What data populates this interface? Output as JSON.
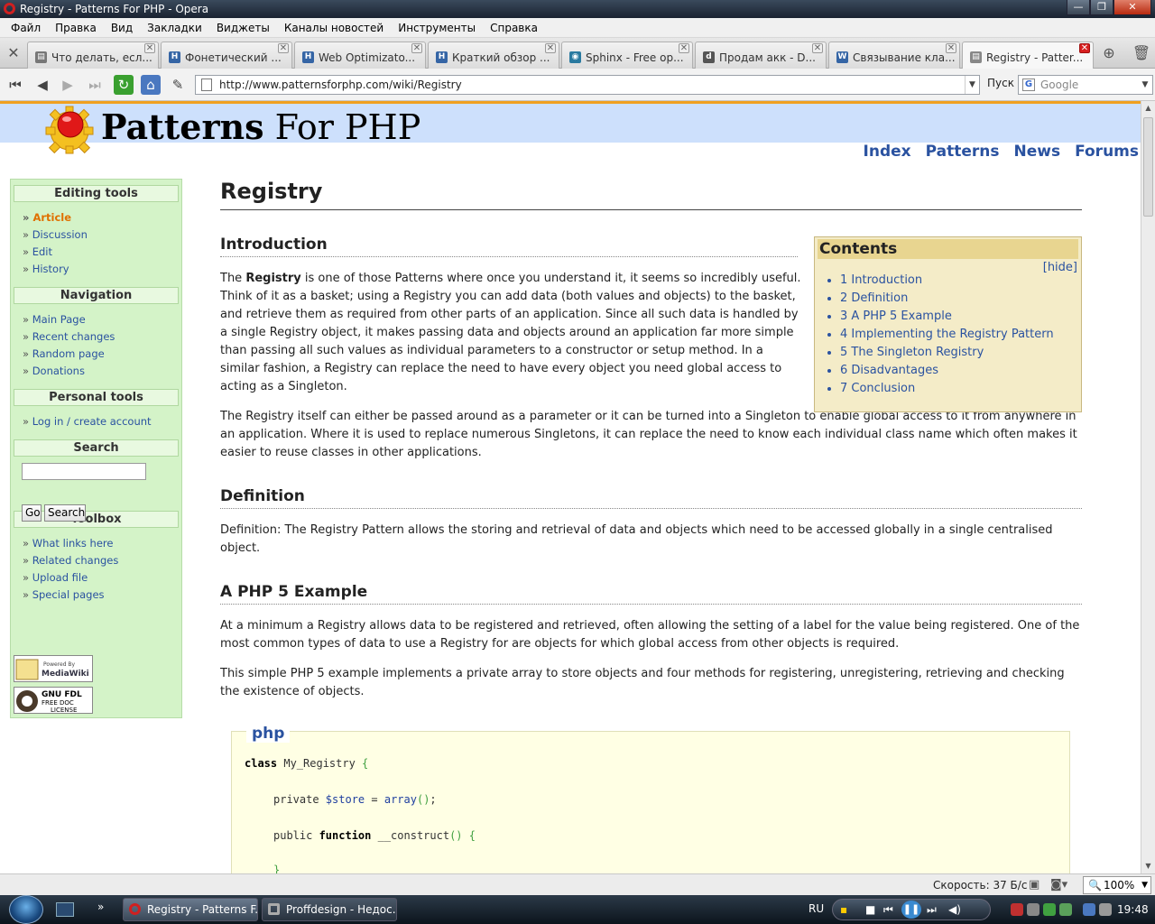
{
  "window": {
    "title": "Registry - Patterns For PHP - Opera"
  },
  "menu": [
    "Файл",
    "Правка",
    "Вид",
    "Закладки",
    "Виджеты",
    "Каналы новостей",
    "Инструменты",
    "Справка"
  ],
  "tabs": [
    {
      "label": "Что делать, есл...",
      "icon": "page-icon"
    },
    {
      "label": "Фонетический ...",
      "icon": "H"
    },
    {
      "label": "Web Optimizato...",
      "icon": "H"
    },
    {
      "label": "Краткий обзор ...",
      "icon": "H"
    },
    {
      "label": "Sphinx - Free op...",
      "icon": "eye-icon"
    },
    {
      "label": "Продам акк - D...",
      "icon": "dp"
    },
    {
      "label": "Связывание кла...",
      "icon": "W"
    },
    {
      "label": "Registry - Patter...",
      "icon": "page-icon",
      "active": true
    }
  ],
  "address": {
    "url": "http://www.patternsforphp.com/wiki/Registry",
    "go_label": "Пуск"
  },
  "search": {
    "placeholder": "Google"
  },
  "site": {
    "title_bold": "Patterns",
    "title_rest": " For PHP",
    "nav": [
      "Index",
      "Patterns",
      "News",
      "Forums"
    ]
  },
  "sidebar": {
    "editing": {
      "title": "Editing tools",
      "items": [
        "Article",
        "Discussion",
        "Edit",
        "History"
      ]
    },
    "navigation": {
      "title": "Navigation",
      "items": [
        "Main Page",
        "Recent changes",
        "Random page",
        "Donations"
      ]
    },
    "personal": {
      "title": "Personal tools",
      "items": [
        "Log in / create account"
      ]
    },
    "search": {
      "title": "Search",
      "go": "Go",
      "search": "Search"
    },
    "toolbox": {
      "title": "Toolbox",
      "items": [
        "What links here",
        "Related changes",
        "Upload file",
        "Special pages"
      ]
    },
    "badges": {
      "mediawiki": "Powered By MediaWiki",
      "gnu": "GNU FDL FREE DOC LICENSE"
    }
  },
  "article": {
    "title": "Registry",
    "intro_heading": "Introduction",
    "intro_p1_pre": "The ",
    "intro_p1_bold": "Registry",
    "intro_p1_post": " is one of those Patterns where once you understand it, it seems so incredibly useful. Think of it as a basket; using a Registry you can add data (both values and objects) to the basket, and retrieve them as required from other parts of an application. Since all such data is handled by a single Registry object, it makes passing data and objects around an application far more simple than passing all such values as individual parameters to a constructor or setup method. In a similar fashion, a Registry can replace the need to have every object you need global access to acting as a Singleton.",
    "intro_p2": "The Registry itself can either be passed around as a parameter or it can be turned into a Singleton to enable global access to it from anywhere in an application. Where it is used to replace numerous Singletons, it can replace the need to know each individual class name which often makes it easier to reuse classes in other applications.",
    "def_heading": "Definition",
    "def_p": "Definition: The Registry Pattern allows the storing and retrieval of data and objects which need to be accessed globally in a single centralised object.",
    "example_heading": "A PHP 5 Example",
    "example_p1": "At a minimum a Registry allows data to be registered and retrieved, often allowing the setting of a label for the value being registered. One of the most common types of data to use a Registry for are objects for which global access from other objects is required.",
    "example_p2": "This simple PHP 5 example implements a private array to store objects and four methods for registering, unregistering, retrieving and checking the existence of objects.",
    "code_label": "php",
    "code": {
      "line1_kw": "class",
      "line1_name": " My_Registry ",
      "line1_brace": "{",
      "line2_pre": "private ",
      "line2_var": "$store",
      "line2_eq": " = ",
      "line2_kw": "array",
      "line2_paren": "()",
      "line2_semi": ";",
      "line3_pre": "public ",
      "line3_kw": "function",
      "line3_name": " __construct",
      "line3_paren": "()",
      "line3_brace": " {",
      "line4": "}"
    }
  },
  "toc": {
    "title": "Contents",
    "hide": "hide",
    "items": [
      "1 Introduction",
      "2 Definition",
      "3 A PHP 5 Example",
      "4 Implementing the Registry Pattern",
      "5 The Singleton Registry",
      "6 Disadvantages",
      "7 Conclusion"
    ]
  },
  "status": {
    "speed_label": "Скорость:",
    "speed_value": "37 Б/с",
    "zoom": "100%"
  },
  "taskbar": {
    "tasks": [
      "Registry - Patterns F...",
      "Proffdesign - Недос..."
    ],
    "lang": "RU",
    "clock": "19:48"
  }
}
